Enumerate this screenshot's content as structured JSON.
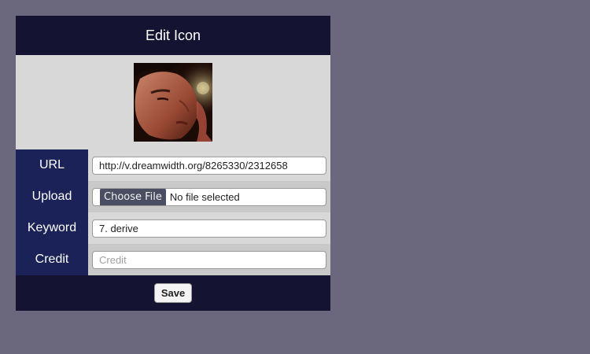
{
  "header": {
    "title": "Edit Icon"
  },
  "preview": {
    "icon_name": "user-icon-photo"
  },
  "fields": {
    "url": {
      "label": "URL",
      "value": "http://v.dreamwidth.org/8265330/2312658"
    },
    "upload": {
      "label": "Upload",
      "button_label": "Choose File",
      "status": "No file selected"
    },
    "keyword": {
      "label": "Keyword",
      "value": "7. derive"
    },
    "credit": {
      "label": "Credit",
      "value": "",
      "placeholder": "Credit"
    }
  },
  "footer": {
    "save_label": "Save"
  },
  "colors": {
    "background": "#6b687e",
    "header": "#141331",
    "label_cell": "#1b2258",
    "field_cell": "#d8d8d8"
  }
}
